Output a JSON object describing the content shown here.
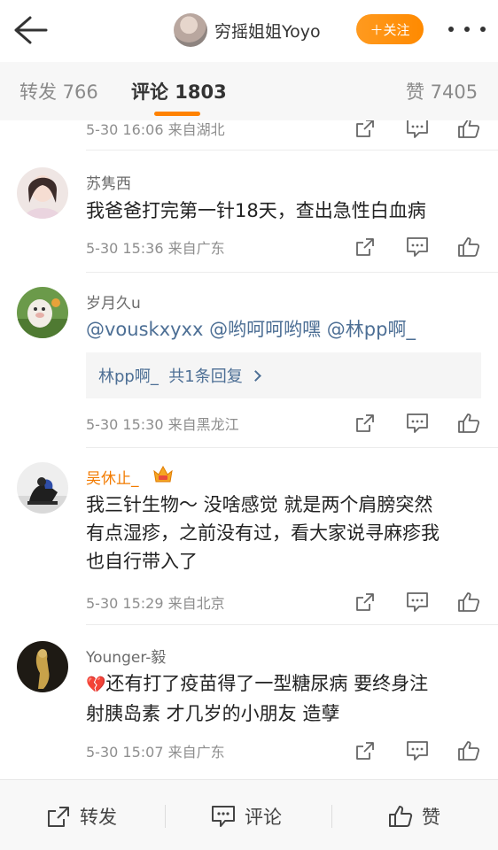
{
  "header": {
    "back_icon": "arrow-left-icon",
    "user_name": "穷摇姐姐Yoyo",
    "follow_label": "＋关注",
    "more_icon": "more-dots-icon"
  },
  "tabs": {
    "repost": "转发 766",
    "comments": "评论 1803",
    "likes": "赞 7405"
  },
  "comments": [
    {
      "meta": "5-30 16:06 来自湖北"
    },
    {
      "name": "苏隽西",
      "text": "我爸爸打完第一针18天，查出急性白血病",
      "meta": "5-30 15:36 来自广东"
    },
    {
      "name": "岁月久u",
      "mentions": [
        "@vouskxyxx",
        "@哟呵呵哟嘿",
        "@林pp啊_"
      ],
      "reply_summary": "林pp啊_  共1条回复",
      "meta": "5-30 15:30 来自黑龙江"
    },
    {
      "name": "吴休止_",
      "badge_icon": "vip-crown-badge-icon",
      "text_lines": [
        "我三针生物～ 没啥感觉  就是两个肩膀突然",
        "有点湿疹，之前没有过，看大家说寻麻疹我",
        "也自行带入了"
      ],
      "meta": "5-30 15:29 来自北京"
    },
    {
      "name": "Younger-毅",
      "emoji": "💔",
      "text_lines": [
        "还有打了疫苗得了一型糖尿病 要终身注",
        "射胰岛素 才几岁的小朋友 造孽"
      ],
      "meta": "5-30 15:07 来自广东"
    }
  ],
  "action_icons": [
    "share-icon",
    "reply-icon",
    "like-icon"
  ],
  "bottom_bar": {
    "repost": "转发",
    "comment": "评论",
    "like": "赞"
  },
  "colors": {
    "accent": "#ff8200",
    "link": "#4d6f95",
    "vip_name": "#f27b00"
  }
}
